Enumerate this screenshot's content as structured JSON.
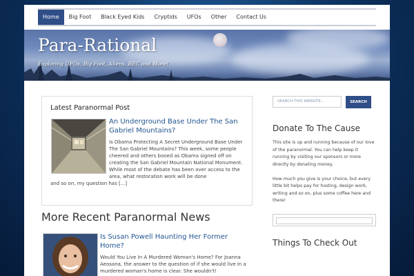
{
  "nav": {
    "items": [
      {
        "label": "Home",
        "active": true
      },
      {
        "label": "Big Foot",
        "active": false
      },
      {
        "label": "Black Eyed Kids",
        "active": false
      },
      {
        "label": "Cryptids",
        "active": false
      },
      {
        "label": "UFOs",
        "active": false
      },
      {
        "label": "Other",
        "active": false
      },
      {
        "label": "Contact Us",
        "active": false
      }
    ]
  },
  "header": {
    "title": "Para-Rational",
    "tagline": "Exploring UFOs, Big Foot, Aliens, BEC and More!"
  },
  "featured": {
    "heading": "Latest Paranormal Post",
    "title": "An Underground Base Under The San Gabriel Mountains?",
    "excerpt": "Is Obama Protecting A Secret Underground Base Under The San Gabriel Mountains? This week, some people cheered and others booed as Obama signed off on creating the San Gabriel Mountain National Monument.  While most of the debate has been over access to the area, what restoration work will be done",
    "excerpt_cont": "and so on, my question has [...]"
  },
  "more": {
    "heading": "More Recent Paranormal News",
    "post_title": "Is Susan Powell Haunting Her Former Home?",
    "post_excerpt": "Would You Live In A Murdered Woman's Home? For Joanna Aeosana, the answer to the question of if she would live in a murdered woman's home is clear.  She wouldn't!"
  },
  "sidebar": {
    "search_placeholder": "SEARCH THIS WEBSITE...",
    "search_button": "SEARCH",
    "donate_heading": "Donate To The Cause",
    "donate_p1": "This site is up and running because of our love of the paranormal. You can help keep it running by visiting our sponsors or more directly by donating money.",
    "donate_p2": "How much you give is your choice, but every little bit helps pay for hosting, design work, writing and so on, plus some coffee here and there!",
    "things_heading": "Things To Check Out"
  },
  "colors": {
    "accent": "#2f4d86",
    "link": "#21558f",
    "background": "#0d3463"
  }
}
